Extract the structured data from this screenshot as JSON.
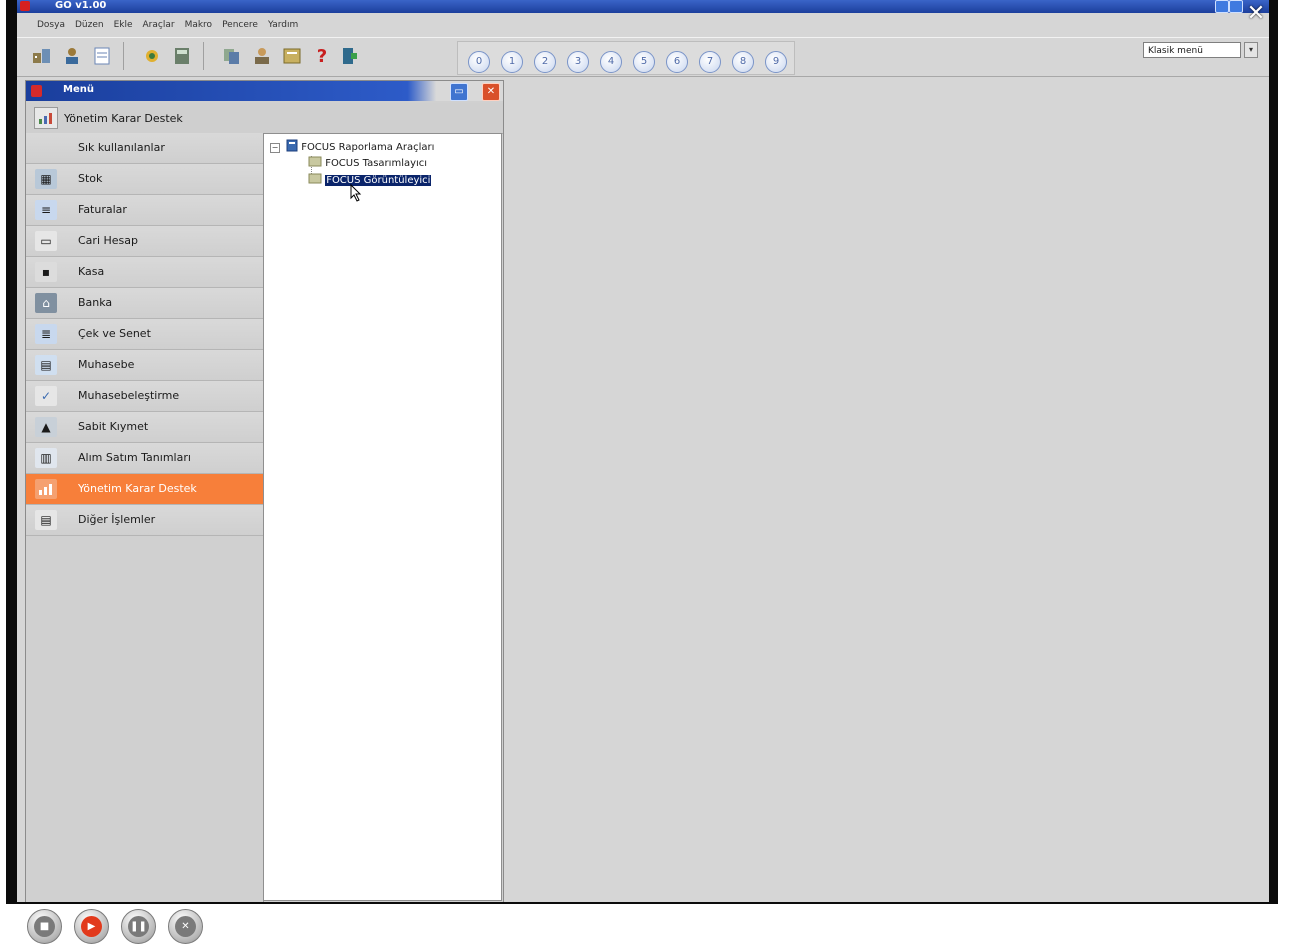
{
  "window": {
    "title": "GO v1.00",
    "close_glyph": "✕"
  },
  "menubar": [
    "Dosya",
    "Düzen",
    "Ekle",
    "Araçlar",
    "Makro",
    "Pencere",
    "Yardım"
  ],
  "toolbar": {
    "icons": [
      "company-icon",
      "user-icon",
      "document-icon",
      "tools-icon",
      "calculator-icon",
      "copy-icon",
      "person-icon",
      "report-icon",
      "help-icon",
      "exit-icon"
    ],
    "help_glyph": "?",
    "numbered_buttons": [
      "0",
      "1",
      "2",
      "3",
      "4",
      "5",
      "6",
      "7",
      "8",
      "9"
    ],
    "theme_select": {
      "value": "Klasik menü",
      "arrow": "▾"
    }
  },
  "menu_window": {
    "title": "Menü",
    "header_label": "Yönetim Karar Destek",
    "sidebar_items": [
      {
        "label": "Sık kullanılanlar",
        "icon": ""
      },
      {
        "label": "Stok",
        "icon": "stock-icon"
      },
      {
        "label": "Faturalar",
        "icon": "invoice-icon"
      },
      {
        "label": "Cari Hesap",
        "icon": "account-icon"
      },
      {
        "label": "Kasa",
        "icon": "cash-icon"
      },
      {
        "label": "Banka",
        "icon": "bank-icon"
      },
      {
        "label": "Çek ve Senet",
        "icon": "check-icon"
      },
      {
        "label": "Muhasebe",
        "icon": "accounting-icon"
      },
      {
        "label": "Muhasebeleştirme",
        "icon": "posting-icon"
      },
      {
        "label": "Sabit Kıymet",
        "icon": "fixed-asset-icon"
      },
      {
        "label": "Alım Satım Tanımları",
        "icon": "definitions-icon"
      },
      {
        "label": "Yönetim Karar Destek",
        "icon": "chart-icon",
        "active": true
      },
      {
        "label": "Diğer İşlemler",
        "icon": "other-icon"
      }
    ],
    "tree": {
      "root": "FOCUS Raporlama Araçları",
      "expander": "−",
      "children": [
        {
          "label": "FOCUS Tasarımlayıcı",
          "selected": false
        },
        {
          "label": "FOCUS Görüntüleyici",
          "selected": true
        }
      ]
    }
  },
  "player_controls": [
    {
      "name": "stop-button",
      "glyph": "■"
    },
    {
      "name": "play-button",
      "glyph": "▶"
    },
    {
      "name": "pause-button",
      "glyph": "❚❚"
    },
    {
      "name": "close-player-button",
      "glyph": "✕"
    }
  ],
  "colors": {
    "title_blue": "#1c3f9c",
    "active_orange": "#f77f3a",
    "selection_navy": "#0a246a"
  }
}
